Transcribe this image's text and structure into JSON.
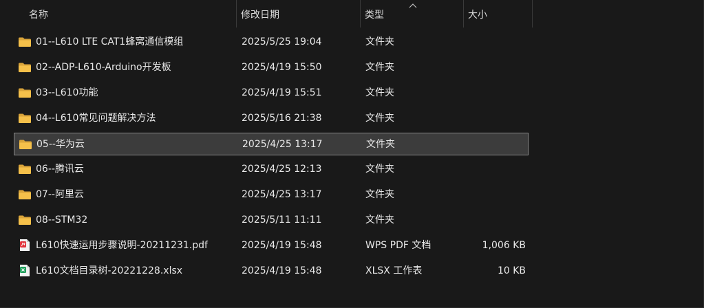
{
  "columns": {
    "name": "名称",
    "date": "修改日期",
    "type": "类型",
    "size": "大小"
  },
  "files": [
    {
      "name": "01--L610 LTE CAT1蜂窝通信模组",
      "date": "2025/5/25 19:04",
      "type": "文件夹",
      "size": "",
      "icon": "folder-icon"
    },
    {
      "name": "02--ADP-L610-Arduino开发板",
      "date": "2025/4/19 15:50",
      "type": "文件夹",
      "size": "",
      "icon": "folder-icon"
    },
    {
      "name": "03--L610功能",
      "date": "2025/4/19 15:51",
      "type": "文件夹",
      "size": "",
      "icon": "folder-icon"
    },
    {
      "name": "04--L610常见问题解决方法",
      "date": "2025/5/16 21:38",
      "type": "文件夹",
      "size": "",
      "icon": "folder-icon"
    },
    {
      "name": "05--华为云",
      "date": "2025/4/25 13:17",
      "type": "文件夹",
      "size": "",
      "icon": "folder-icon",
      "selected": true
    },
    {
      "name": "06--腾讯云",
      "date": "2025/4/25 12:13",
      "type": "文件夹",
      "size": "",
      "icon": "folder-icon"
    },
    {
      "name": "07--阿里云",
      "date": "2025/4/25 13:17",
      "type": "文件夹",
      "size": "",
      "icon": "folder-icon"
    },
    {
      "name": "08--STM32",
      "date": "2025/5/11 11:11",
      "type": "文件夹",
      "size": "",
      "icon": "folder-icon"
    },
    {
      "name": "L610快速运用步骤说明-20211231.pdf",
      "date": "2025/4/19 15:48",
      "type": "WPS PDF 文档",
      "size": "1,006 KB",
      "icon": "pdf-icon"
    },
    {
      "name": "L610文档目录树-20221228.xlsx",
      "date": "2025/4/19 15:48",
      "type": "XLSX 工作表",
      "size": "10 KB",
      "icon": "xlsx-icon"
    }
  ],
  "colors": {
    "background": "#191919",
    "folder": "#f5c04a",
    "pdf": "#e0333b",
    "xlsx": "#1e9e5a",
    "selection": "#3c3c3c"
  }
}
